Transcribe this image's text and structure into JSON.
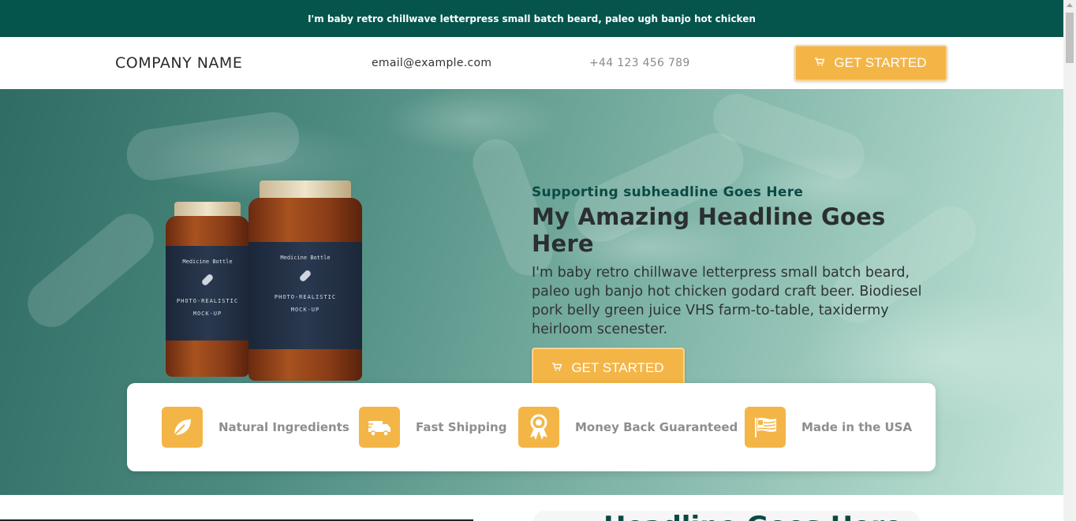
{
  "announcement": {
    "text": "I'm baby retro chillwave letterpress small batch beard, paleo ugh banjo hot chicken"
  },
  "header": {
    "company_name": "COMPANY NAME",
    "email": "email@example.com",
    "phone": "+44 123 456 789",
    "cta_label": "GET STARTED",
    "cta_icon": "cart-icon"
  },
  "hero": {
    "subheadline": "Supporting subheadline Goes Here",
    "headline": "My Amazing Headline Goes Here",
    "body": "I'm baby retro chillwave letterpress small batch beard, paleo ugh banjo hot chicken godard craft beer. Biodiesel pork belly green juice VHS farm-to-table, taxidermy heirloom scenester.",
    "cta_label": "GET STARTED",
    "cta_icon": "cart-icon",
    "bottle_front": {
      "line1": "Medicine Bottle",
      "line2": "PHOTO-REALISTIC",
      "line3": "MOCK-UP"
    },
    "bottle_back": {
      "line1": "Medicine Bottle",
      "line2": "PHOTO-REALISTIC",
      "line3": "MOCK-UP"
    }
  },
  "features": [
    {
      "label": "Natural Ingredients",
      "icon": "leaf-icon"
    },
    {
      "label": "Fast Shipping",
      "icon": "truck-icon"
    },
    {
      "label": "Money Back Guaranteed",
      "icon": "award-ribbon-icon"
    },
    {
      "label": "Made in the USA",
      "icon": "flag-icon"
    }
  ],
  "next_section": {
    "heading_partial": "Headline Goes Here"
  },
  "colors": {
    "brand_dark": "#06554d",
    "accent": "#f4b547",
    "headline": "#2a2f30",
    "feature_text": "#8e8e8e"
  }
}
